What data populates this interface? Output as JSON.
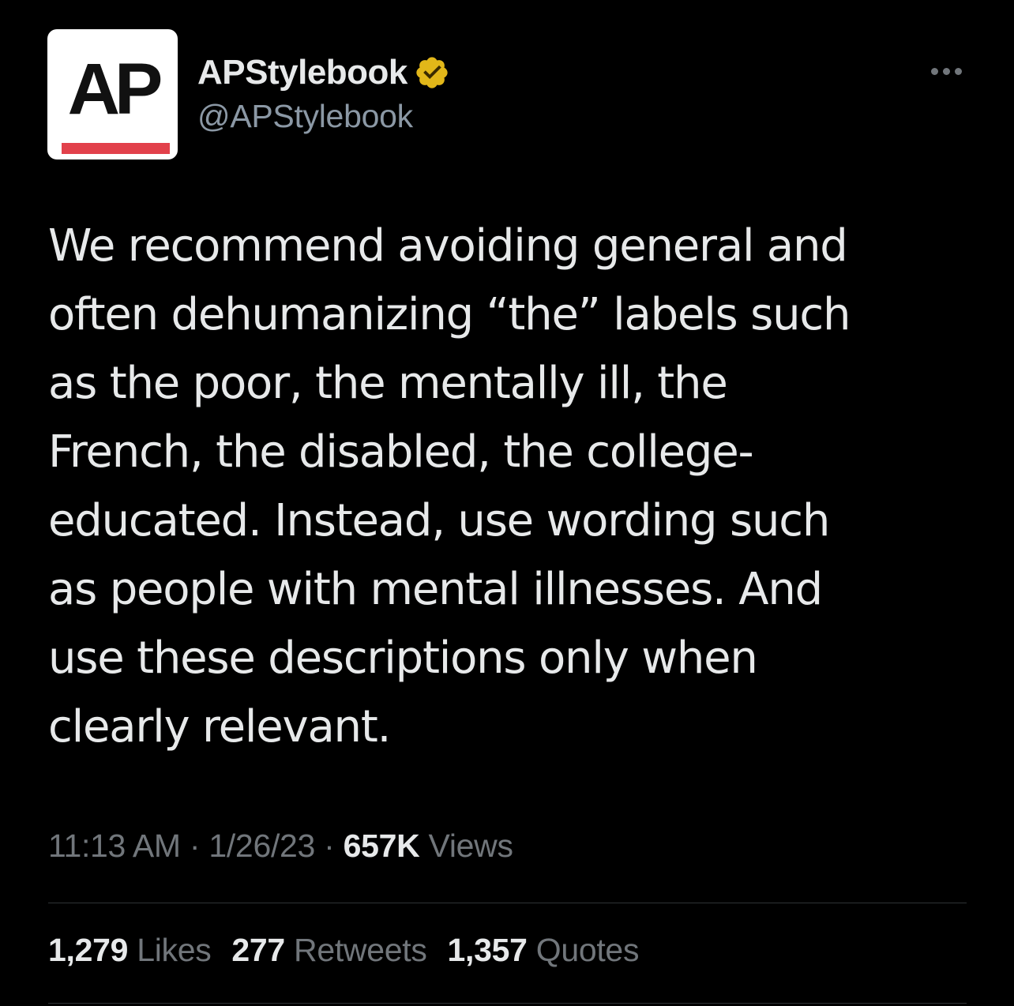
{
  "author": {
    "avatar_text": "AP",
    "display_name": "APStylebook",
    "handle": "@APStylebook",
    "verified": true,
    "verified_badge_color": "#e2b719",
    "brand_red": "#e2414b"
  },
  "menu": {
    "icon": "more-horizontal-icon"
  },
  "tweet": {
    "lines": [
      "We recommend avoiding general and",
      "often dehumanizing “the” labels such",
      "as the poor, the mentally ill, the",
      "French, the disabled, the college-",
      "educated. Instead, use wording such",
      "as people with mental illnesses. And",
      "use these descriptions only when",
      "clearly relevant."
    ]
  },
  "meta": {
    "time": "11:13 AM",
    "separator": " · ",
    "date": "1/26/23",
    "views_count": "657K",
    "views_label": "Views"
  },
  "stats": {
    "likes_count": "1,279",
    "likes_label": "Likes",
    "retweets_count": "277",
    "retweets_label": "Retweets",
    "quotes_count": "1,357",
    "quotes_label": "Quotes"
  }
}
